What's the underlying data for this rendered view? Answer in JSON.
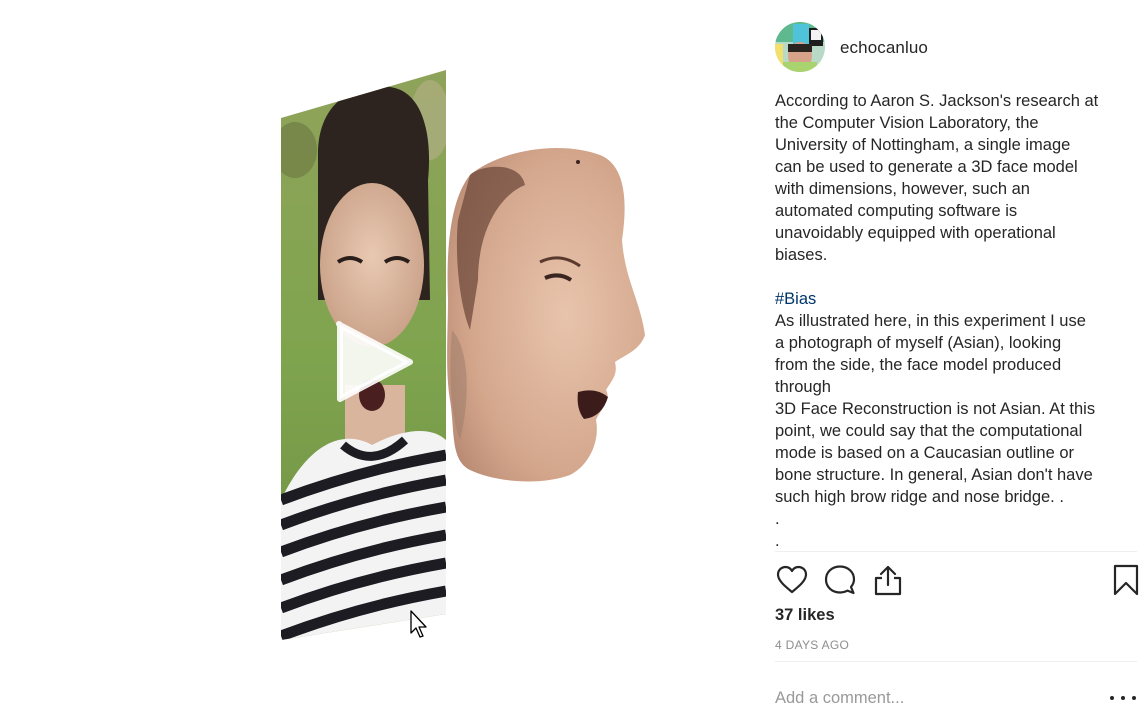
{
  "post": {
    "username": "echocanluo",
    "caption_lines_1": [
      "According to Aaron S. Jackson's research at",
      "the Computer Vision Laboratory, the",
      "University of Nottingham, a single image",
      "can be used to generate a 3D face model",
      "with dimensions, however, such an",
      "automated computing software is",
      "unavoidably equipped with operational",
      "biases."
    ],
    "hashtag": "#Bias",
    "caption_lines_2": [
      "As illustrated here, in this experiment I use",
      "a photograph of myself (Asian), looking",
      "from the side, the face model produced",
      "through",
      "3D Face Reconstruction is not Asian. At this",
      "point, we could say that the computational",
      "mode is based on a Caucasian outline or",
      "bone structure. In general, Asian don't have",
      "such high brow ridge and nose bridge. .",
      ".",
      "."
    ],
    "likes": "37 likes",
    "timestamp": "4 DAYS AGO",
    "comment_placeholder": "Add a comment..."
  },
  "icons": {
    "like": "heart-outline-icon",
    "comment": "speech-bubble-icon",
    "share": "share-upload-icon",
    "save": "bookmark-icon",
    "more": "ellipsis-icon",
    "play": "play-icon",
    "cursor": "mouse-cursor-icon"
  },
  "colors": {
    "text": "#262626",
    "muted": "#8e8e8e",
    "hashtag": "#003569",
    "divider": "#efefef"
  }
}
